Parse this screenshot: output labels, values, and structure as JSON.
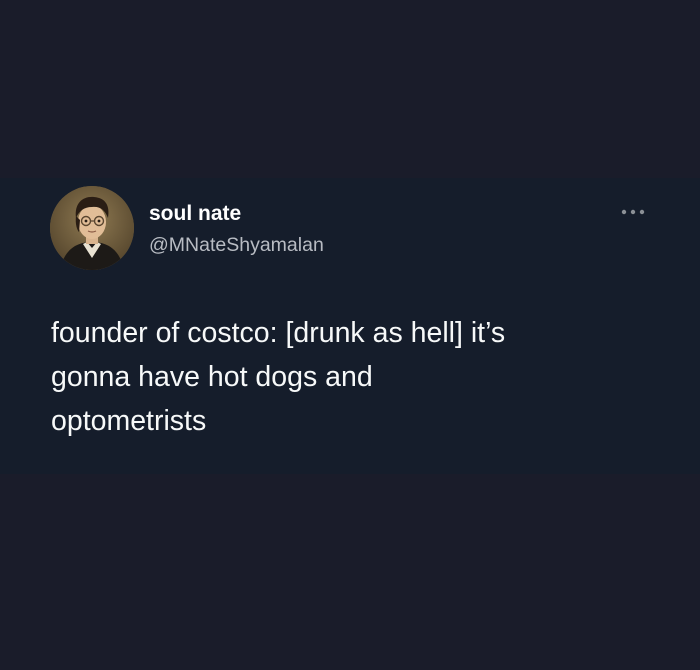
{
  "tweet": {
    "display_name": "soul nate",
    "handle": "@MNateShyamalan",
    "text": "founder of costco: [drunk as hell] it’s\ngonna have hot dogs and\noptometrists",
    "more_icon": "more-horizontal-icon",
    "avatar_icon": "avatar-portrait-painting"
  },
  "colors": {
    "page_background": "#1a1c2a",
    "card_background": "#151d2b",
    "primary_text": "#f7f9f9",
    "secondary_text": "#b8bcc3"
  }
}
